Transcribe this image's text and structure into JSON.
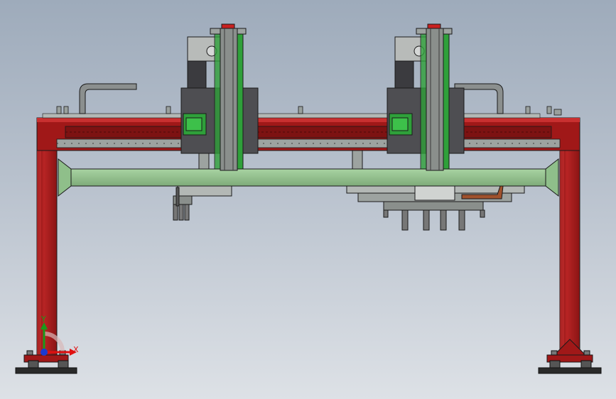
{
  "viewport": {
    "title": "",
    "background_top": "#9eabbb",
    "background_bottom": "#dde1e6"
  },
  "model": {
    "frame_color": "#a01818",
    "frame_highlight": "#c83030",
    "beam_color": "#8fbf8a",
    "carriage_color": "#4e4e52",
    "carriage_accent_color": "#2fa03a",
    "rail_color": "#8a8f8c",
    "edge_color": "#1a1a1a"
  },
  "triad": {
    "x_label": "X",
    "y_label": "Y",
    "x_color": "#e01010",
    "y_color": "#1a9a1a",
    "z_color": "#1a3ad0"
  }
}
